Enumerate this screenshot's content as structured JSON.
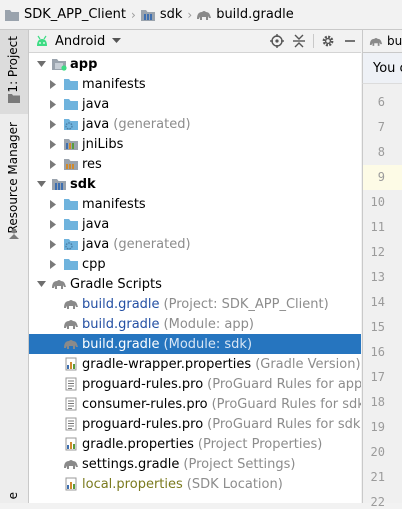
{
  "breadcrumb": {
    "items": [
      {
        "label": "SDK_APP_Client",
        "icon": "folder-icon"
      },
      {
        "label": "sdk",
        "icon": "module-folder-icon"
      },
      {
        "label": "build.gradle",
        "icon": "gradle-elephant-icon"
      }
    ]
  },
  "left_strip": {
    "project_tab": "1: Project",
    "resource_manager_tab": "Resource Manager",
    "bottom_tab_fragment": "e"
  },
  "project_tool": {
    "view_mode": "Android",
    "icons": [
      "crosshair-icon",
      "collapse-all-icon",
      "gear-icon",
      "minimize-icon"
    ]
  },
  "tree": {
    "rows": [
      {
        "label": "app",
        "hint": "",
        "level": 0,
        "expanded": true,
        "icon": "app-module-icon",
        "bold": true
      },
      {
        "label": "manifests",
        "hint": "",
        "level": 1,
        "expanded": false,
        "icon": "folder-icon"
      },
      {
        "label": "java",
        "hint": "",
        "level": 1,
        "expanded": false,
        "icon": "folder-icon"
      },
      {
        "label": "java",
        "hint": "(generated)",
        "level": 1,
        "expanded": false,
        "icon": "generated-folder-icon"
      },
      {
        "label": "jniLibs",
        "hint": "",
        "level": 1,
        "expanded": false,
        "icon": "libs-folder-icon"
      },
      {
        "label": "res",
        "hint": "",
        "level": 1,
        "expanded": false,
        "icon": "res-folder-icon"
      },
      {
        "label": "sdk",
        "hint": "",
        "level": 0,
        "expanded": true,
        "icon": "library-module-icon",
        "bold": true
      },
      {
        "label": "manifests",
        "hint": "",
        "level": 1,
        "expanded": false,
        "icon": "folder-icon"
      },
      {
        "label": "java",
        "hint": "",
        "level": 1,
        "expanded": false,
        "icon": "folder-icon"
      },
      {
        "label": "java",
        "hint": "(generated)",
        "level": 1,
        "expanded": false,
        "icon": "generated-folder-icon"
      },
      {
        "label": "cpp",
        "hint": "",
        "level": 1,
        "expanded": false,
        "icon": "folder-icon"
      },
      {
        "label": "Gradle Scripts",
        "hint": "",
        "level": 0,
        "expanded": true,
        "icon": "gradle-elephant-icon"
      },
      {
        "label": "build.gradle",
        "hint": "(Project: SDK_APP_Client)",
        "level": 1,
        "icon": "gradle-elephant-icon",
        "blue": true
      },
      {
        "label": "build.gradle",
        "hint": "(Module: app)",
        "level": 1,
        "icon": "gradle-elephant-icon",
        "blue": true
      },
      {
        "label": "build.gradle",
        "hint": "(Module: sdk)",
        "level": 1,
        "icon": "gradle-elephant-icon",
        "selected": true
      },
      {
        "label": "gradle-wrapper.properties",
        "hint": "(Gradle Version)",
        "level": 1,
        "icon": "properties-file-icon"
      },
      {
        "label": "proguard-rules.pro",
        "hint": "(ProGuard Rules for app)",
        "level": 1,
        "icon": "text-file-icon"
      },
      {
        "label": "consumer-rules.pro",
        "hint": "(ProGuard Rules for sdk)",
        "level": 1,
        "icon": "text-file-icon"
      },
      {
        "label": "proguard-rules.pro",
        "hint": "(ProGuard Rules for sdk)",
        "level": 1,
        "icon": "text-file-icon"
      },
      {
        "label": "gradle.properties",
        "hint": "(Project Properties)",
        "level": 1,
        "icon": "properties-file-icon"
      },
      {
        "label": "settings.gradle",
        "hint": "(Project Settings)",
        "level": 1,
        "icon": "gradle-elephant-icon"
      },
      {
        "label": "local.properties",
        "hint": "(SDK Location)",
        "level": 1,
        "icon": "properties-file-icon",
        "olive": true
      }
    ]
  },
  "editor": {
    "tab_label": "bu",
    "banner_text": "You c",
    "line_numbers": [
      "6",
      "7",
      "8",
      "9",
      "10",
      "11",
      "12",
      "13",
      "14",
      "15",
      "16",
      "17",
      "18",
      "19",
      "20",
      "21",
      "22"
    ],
    "current_line": "9"
  },
  "colors": {
    "selection": "#2675bf",
    "folder": "#6fb3dd",
    "gradle_elephant": "#8a8a8a",
    "link_blue": "#234fa3",
    "hint_gray": "#8c8c8c",
    "android_green": "#3ddc84"
  }
}
